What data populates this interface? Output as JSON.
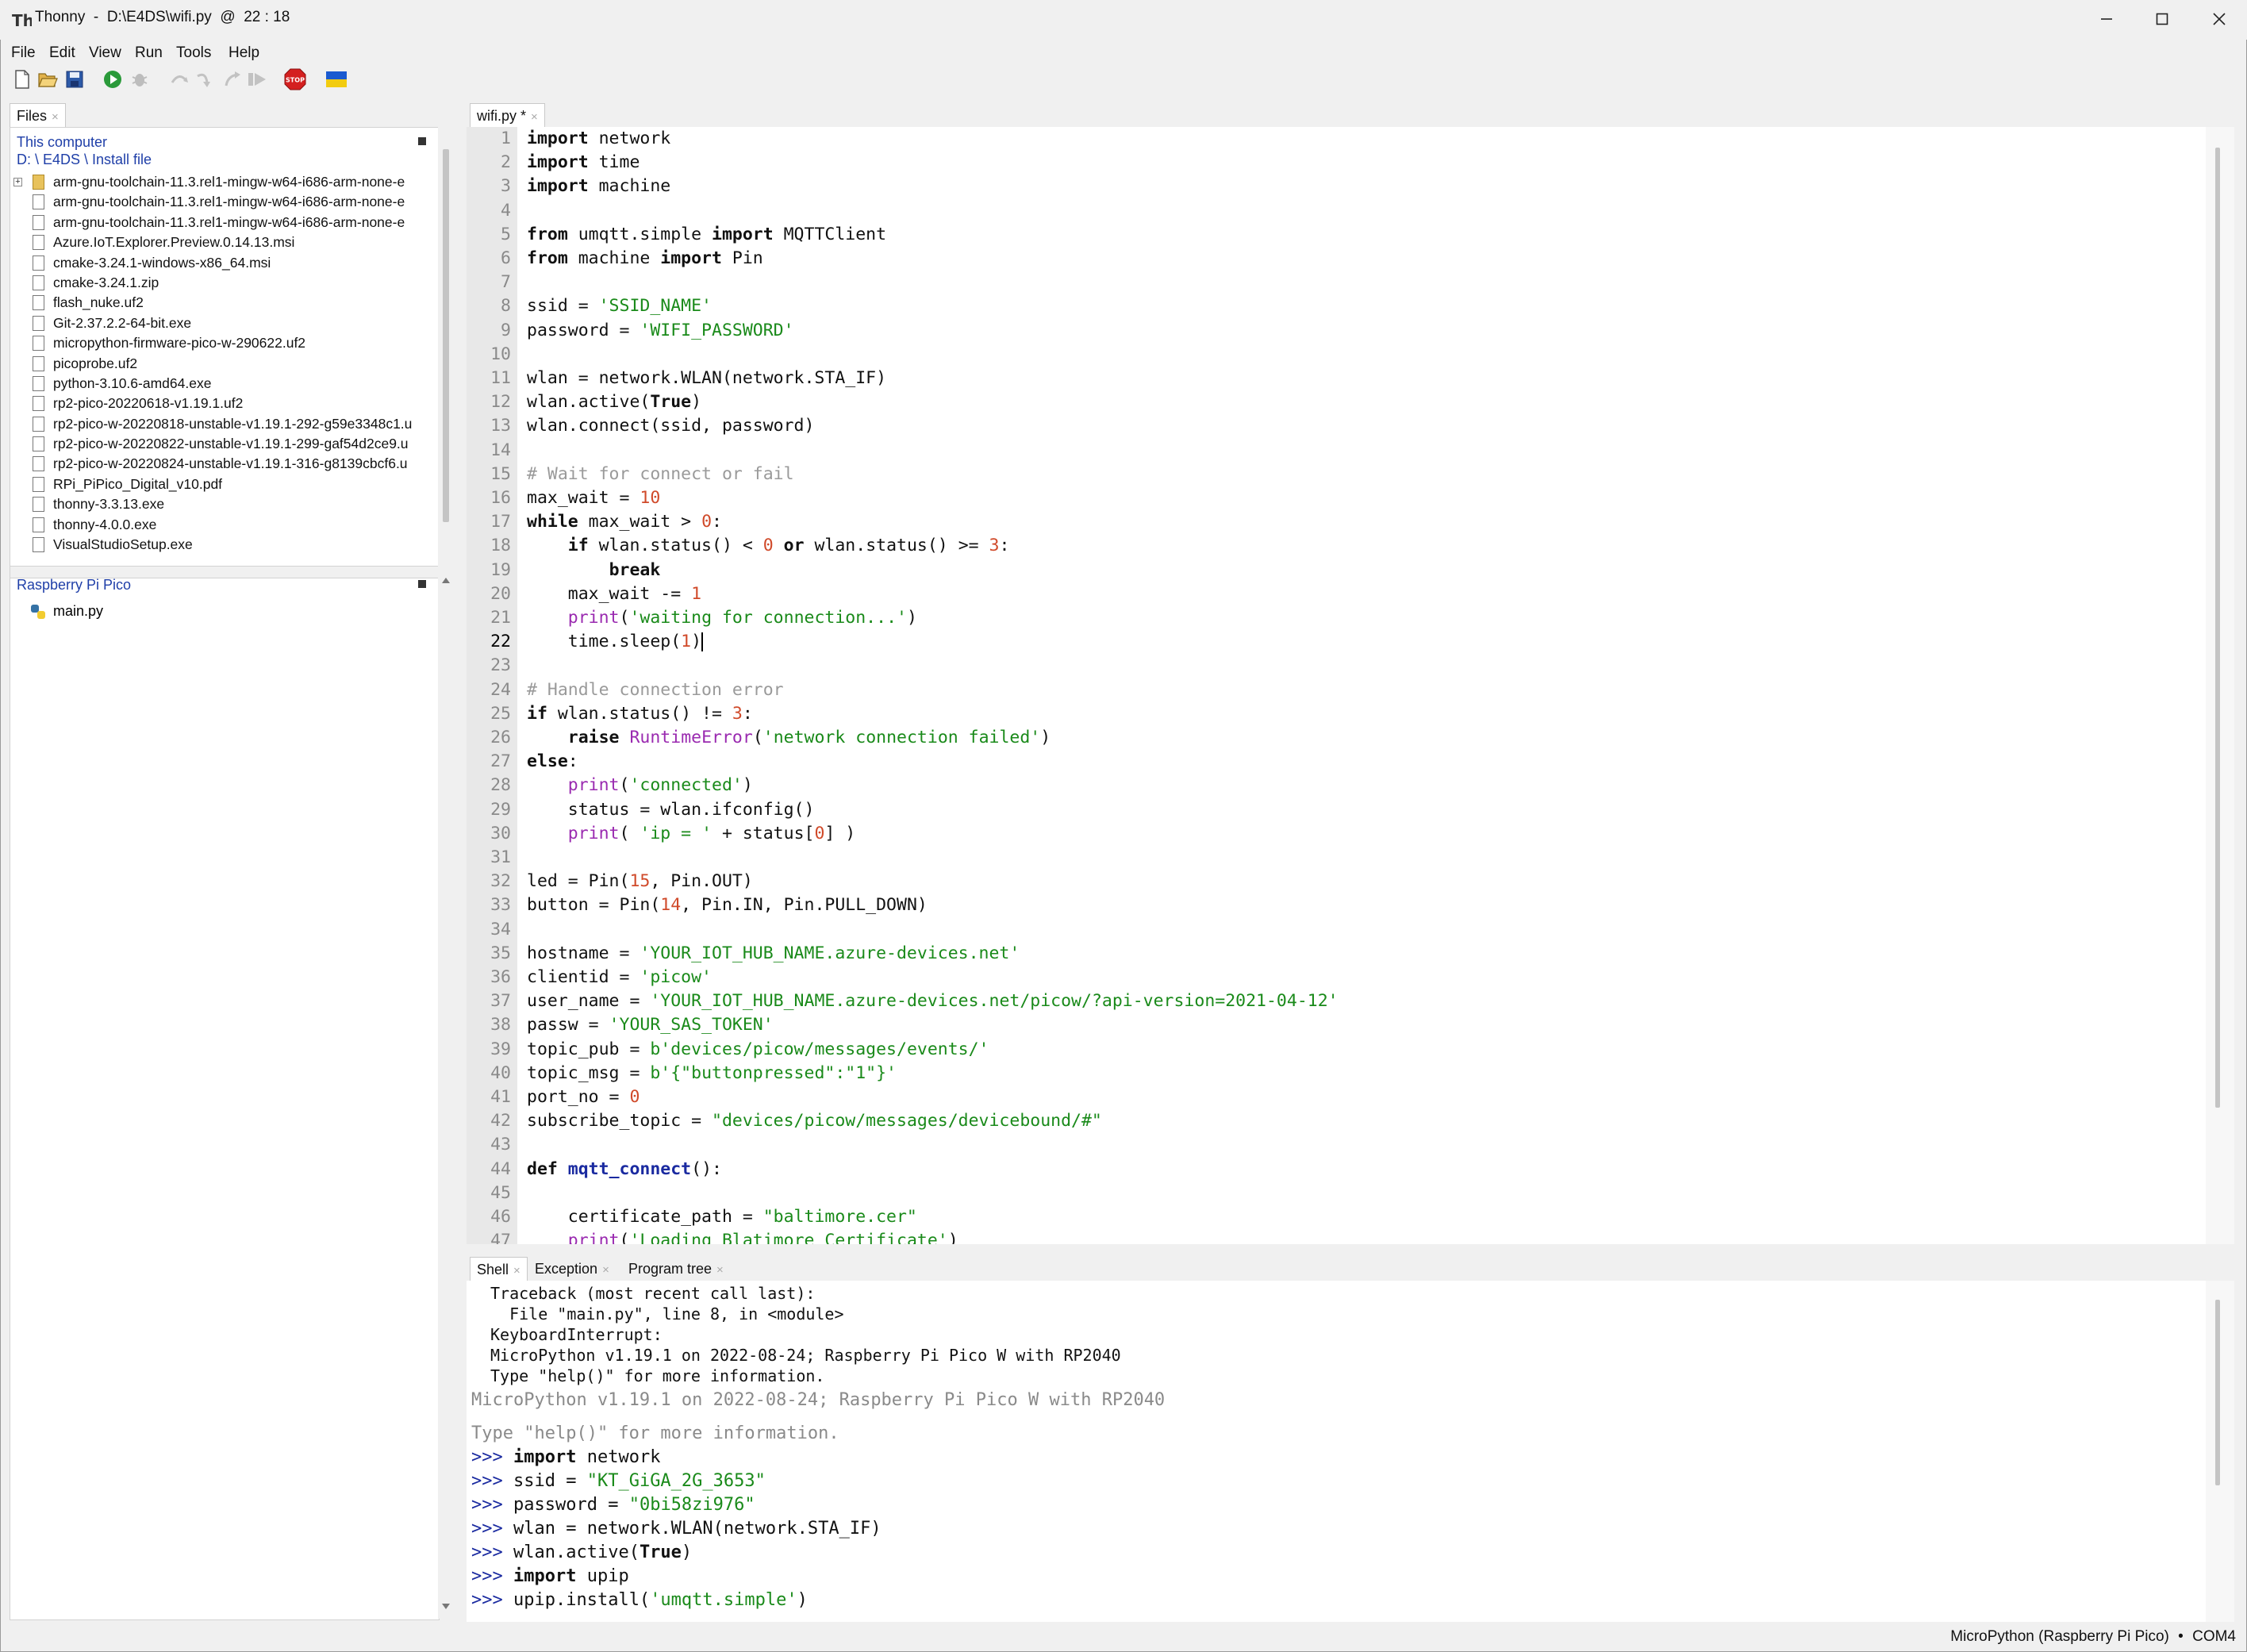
{
  "window": {
    "title": "Thonny  -  D:\\E4DS\\wifi.py  @  22 : 18"
  },
  "menu": [
    "File",
    "Edit",
    "View",
    "Run",
    "Tools",
    "Help"
  ],
  "toolbar": {
    "icons": [
      "new-file-icon",
      "open-file-icon",
      "save-icon",
      "run-icon",
      "debug-icon",
      "step-over-icon",
      "step-into-icon",
      "step-out-icon",
      "resume-icon",
      "stop-icon",
      "ukraine-flag-icon"
    ],
    "stop_label": "STOP"
  },
  "files": {
    "tab_label": "Files",
    "this_computer": "This computer",
    "path": "D: \\ E4DS \\ Install file",
    "items": [
      "arm-gnu-toolchain-11.3.rel1-mingw-w64-i686-arm-none-e",
      "arm-gnu-toolchain-11.3.rel1-mingw-w64-i686-arm-none-e",
      "arm-gnu-toolchain-11.3.rel1-mingw-w64-i686-arm-none-e",
      "Azure.IoT.Explorer.Preview.0.14.13.msi",
      "cmake-3.24.1-windows-x86_64.msi",
      "cmake-3.24.1.zip",
      "flash_nuke.uf2",
      "Git-2.37.2.2-64-bit.exe",
      "micropython-firmware-pico-w-290622.uf2",
      "picoprobe.uf2",
      "python-3.10.6-amd64.exe",
      "rp2-pico-20220618-v1.19.1.uf2",
      "rp2-pico-w-20220818-unstable-v1.19.1-292-g59e3348c1.u",
      "rp2-pico-w-20220822-unstable-v1.19.1-299-gaf54d2ce9.u",
      "rp2-pico-w-20220824-unstable-v1.19.1-316-g8139cbcf6.u",
      "RPi_PiPico_Digital_v10.pdf",
      "thonny-3.3.13.exe",
      "thonny-4.0.0.exe",
      "VisualStudioSetup.exe"
    ],
    "pico_title": "Raspberry Pi Pico",
    "pico_items": [
      "main.py"
    ]
  },
  "editor": {
    "tab_label": "wifi.py *",
    "current_line": 22,
    "lines": [
      "<span class=\"kw\">import</span> network",
      "<span class=\"kw\">import</span> time",
      "<span class=\"kw\">import</span> machine",
      "",
      "<span class=\"kw\">from</span> umqtt.simple <span class=\"kw\">import</span> MQTTClient",
      "<span class=\"kw\">from</span> machine <span class=\"kw\">import</span> Pin",
      "",
      "ssid = <span class=\"str\">'SSID_NAME'</span>",
      "password = <span class=\"str\">'WIFI_PASSWORD'</span>",
      "",
      "wlan = network.WLAN(network.STA_IF)",
      "wlan.active(<span class=\"kw\">True</span>)",
      "wlan.connect(ssid, password)",
      "",
      "<span class=\"cm\"># Wait for connect or fail</span>",
      "max_wait = <span class=\"num\">10</span>",
      "<span class=\"kw\">while</span> max_wait > <span class=\"num\">0</span>:",
      "    <span class=\"kw\">if</span> wlan.status() < <span class=\"num\">0</span> <span class=\"kw\">or</span> wlan.status() >= <span class=\"num\">3</span>:",
      "        <span class=\"kw\">break</span>",
      "    max_wait -= <span class=\"num\">1</span>",
      "    <span class=\"bi\">print</span>(<span class=\"str\">'waiting for connection...'</span>)",
      "    time.sleep(<span class=\"num\">1</span>)<span id=\"caret\"></span>",
      "",
      "<span class=\"cm\"># Handle connection error</span>",
      "<span class=\"kw\">if</span> wlan.status() != <span class=\"num\">3</span>:",
      "    <span class=\"kw\">raise</span> <span class=\"bi\">RuntimeError</span>(<span class=\"str\">'network connection failed'</span>)",
      "<span class=\"kw\">else</span>:",
      "    <span class=\"bi\">print</span>(<span class=\"str\">'connected'</span>)",
      "    status = wlan.ifconfig()",
      "    <span class=\"bi\">print</span>( <span class=\"str\">'ip = '</span> + status[<span class=\"num\">0</span>] )",
      "",
      "led = Pin(<span class=\"num\">15</span>, Pin.OUT)",
      "button = Pin(<span class=\"num\">14</span>, Pin.IN, Pin.PULL_DOWN)",
      "",
      "hostname = <span class=\"str\">'YOUR_IOT_HUB_NAME.azure-devices.net'</span>",
      "clientid = <span class=\"str\">'picow'</span>",
      "user_name = <span class=\"str\">'YOUR_IOT_HUB_NAME.azure-devices.net/picow/?api-version=2021-04-12'</span>",
      "passw = <span class=\"str\">'YOUR_SAS_TOKEN'</span>",
      "topic_pub = <span class=\"str\">b'devices/picow/messages/events/'</span>",
      "topic_msg = <span class=\"str\">b'{\"buttonpressed\":\"1\"}'</span>",
      "port_no = <span class=\"num\">0</span>",
      "subscribe_topic = <span class=\"str\">\"devices/picow/messages/devicebound/#\"</span>",
      "",
      "<span class=\"kw\">def</span> <span class=\"fn\">mqtt_connect</span>():",
      "",
      "    certificate_path = <span class=\"str\">\"baltimore.cer\"</span>",
      "    <span class=\"bi\">print</span>(<span class=\"str\">'Loading Blatimore Certificate'</span>)"
    ]
  },
  "bottom_tabs": [
    "Shell",
    "Exception",
    "Program tree"
  ],
  "shell": {
    "old_output": [
      "Traceback (most recent call last):",
      "  File \"main.py\", line 8, in <module>",
      "KeyboardInterrupt:",
      "MicroPython v1.19.1 on 2022-08-24; Raspberry Pi Pico W with RP2040",
      "Type \"help()\" for more information."
    ],
    "banner": [
      "MicroPython v1.19.1 on 2022-08-24; Raspberry Pi Pico W with RP2040",
      "Type \"help()\" for more information."
    ],
    "prompt": ">>>",
    "commands": [
      "<span class=\"kw\">import</span> network",
      "ssid = <span class=\"str\">\"KT_GiGA_2G_3653\"</span>",
      "password = <span class=\"str\">\"0bi58zi976\"</span>",
      "wlan = network.WLAN(network.STA_IF)",
      "wlan.active(<span class=\"kw\">True</span>)",
      "<span class=\"kw\">import</span> upip",
      "upip.install(<span class=\"str\">'umqtt.simple'</span>)"
    ]
  },
  "status": {
    "interpreter": "MicroPython (Raspberry Pi Pico)",
    "separator": "•",
    "port": "COM4"
  },
  "colors": {
    "keyword": "#111111",
    "string": "#1a8a1a",
    "number": "#d04a2a",
    "comment": "#9a9a9a",
    "builtin": "#9a2ab0",
    "link_blue": "#1f3fa8"
  }
}
